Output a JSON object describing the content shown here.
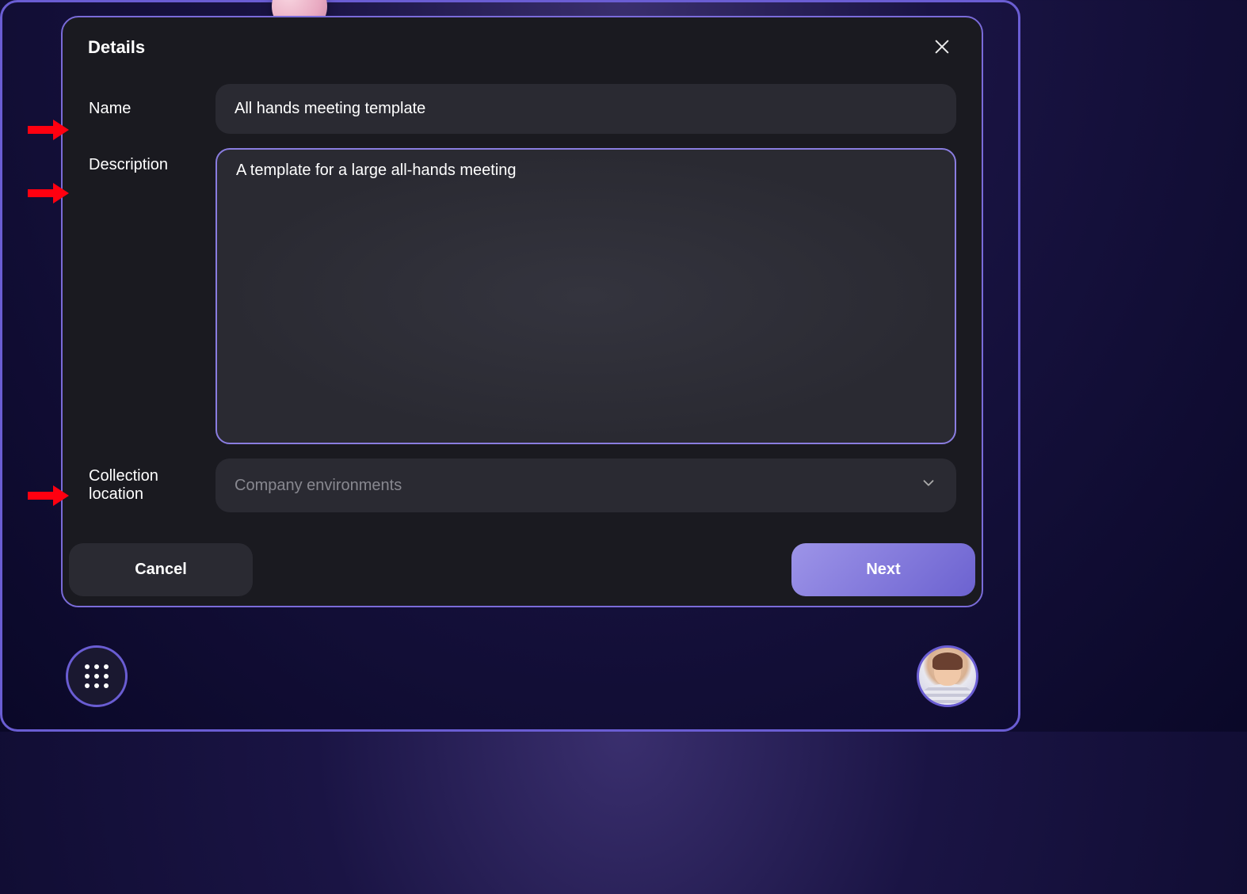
{
  "modal": {
    "title": "Details",
    "fields": {
      "name": {
        "label": "Name",
        "value": "All hands meeting template"
      },
      "description": {
        "label": "Description",
        "value": "A template for a large all-hands meeting"
      },
      "collection_location": {
        "label": "Collection location",
        "selected": "Company environments"
      }
    },
    "footer": {
      "cancel_label": "Cancel",
      "next_label": "Next"
    }
  },
  "annotations": {
    "arrow_color": "#ff0010"
  }
}
